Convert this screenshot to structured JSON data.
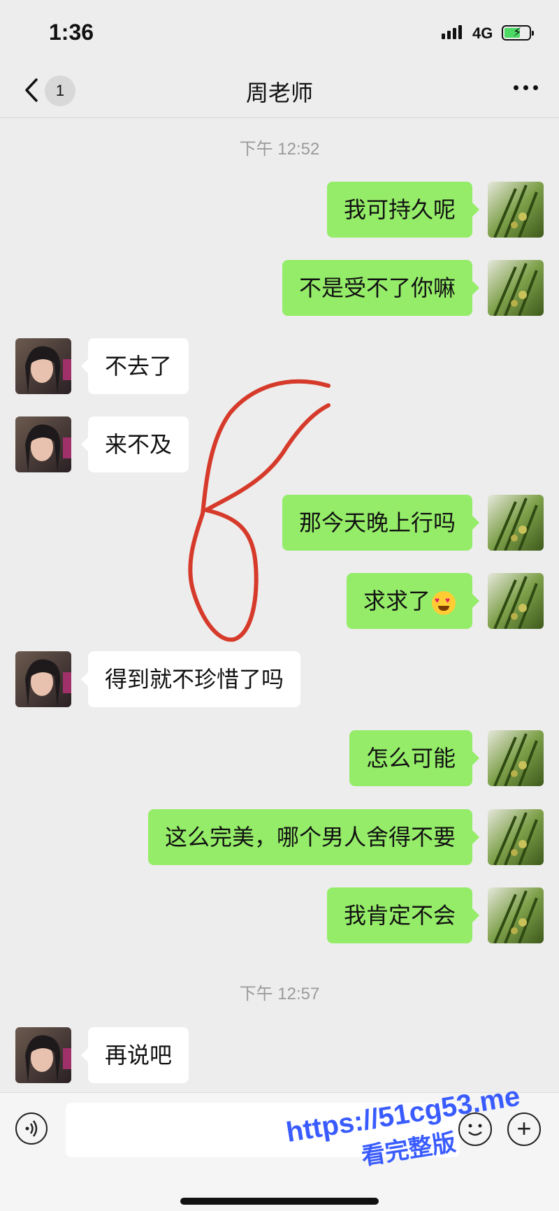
{
  "status_bar": {
    "time": "1:36",
    "network": "4G"
  },
  "header": {
    "unread_count": "1",
    "title": "周老师"
  },
  "timestamps": [
    "下午 12:52",
    "下午 12:57"
  ],
  "messages": [
    {
      "side": "right",
      "text": "我可持久呢"
    },
    {
      "side": "right",
      "text": "不是受不了你嘛"
    },
    {
      "side": "left",
      "text": "不去了"
    },
    {
      "side": "left",
      "text": "来不及"
    },
    {
      "side": "right",
      "text": "那今天晚上行吗"
    },
    {
      "side": "right",
      "text": "求求了"
    },
    {
      "side": "left",
      "text": "得到就不珍惜了吗"
    },
    {
      "side": "right",
      "text": "怎么可能"
    },
    {
      "side": "right",
      "text": "这么完美，哪个男人舍得不要"
    },
    {
      "side": "right",
      "text": "我肯定不会"
    },
    {
      "side": "left",
      "text": "再说吧"
    }
  ],
  "input": {
    "placeholder": ""
  },
  "watermark": {
    "line1": "https://51cg53.me",
    "line2": "看完整版"
  },
  "colors": {
    "sent_bubble": "#95ec69",
    "received_bubble": "#ffffff",
    "background": "#ededed",
    "annotation": "#d63a2a"
  }
}
